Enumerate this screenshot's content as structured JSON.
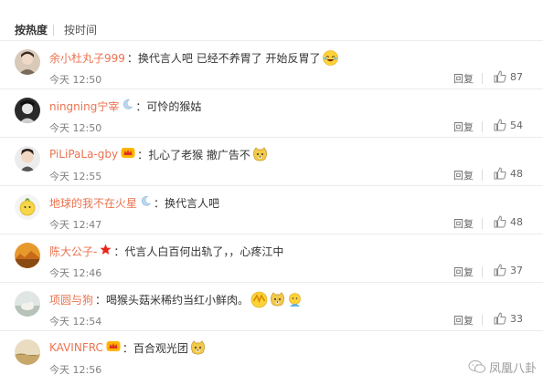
{
  "sort": {
    "hot": "按热度",
    "time": "按时间"
  },
  "ui": {
    "reply_label": "回复",
    "colon": "："
  },
  "comments": [
    {
      "user": "余小杜丸子999",
      "text": "换代言人吧 已经不养胃了 开始反胃了",
      "time": "今天 12:50",
      "likes": "87"
    },
    {
      "user": "ningning宁宰",
      "text": "可怜的猴姑",
      "time": "今天 12:50",
      "likes": "54"
    },
    {
      "user": "PiLiPaLa-gby",
      "text": "扎心了老猴 撤广告不",
      "time": "今天 12:55",
      "likes": "48"
    },
    {
      "user": "地球的我不在火星",
      "text": "换代言人吧",
      "time": "今天 12:47",
      "likes": "48"
    },
    {
      "user": "陈大公子-",
      "text": "代言人白百何出轨了，，心疼江中",
      "time": "今天 12:46",
      "likes": "37"
    },
    {
      "user": "项圆与狗",
      "text": "喝猴头菇米稀约当红小鲜肉。",
      "time": "今天 12:54",
      "likes": "33"
    },
    {
      "user": "KAVINFRC",
      "text": "百合观光团",
      "time": "今天 12:56",
      "likes": ""
    }
  ],
  "watermark": "凤凰八卦",
  "colors": {
    "username": "#eb7350",
    "text": "#333333",
    "meta": "#808080",
    "divider": "#ececec"
  }
}
